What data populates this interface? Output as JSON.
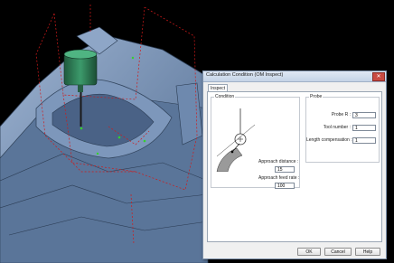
{
  "dialog": {
    "title": "Calculation Condition (OM Inspect)",
    "close_glyph": "✕",
    "tab_label": "Inspect",
    "condition": {
      "legend": "Condition",
      "approach_distance_label": "Approach distance :",
      "approach_distance_value": "15",
      "approach_feed_rate_label": "Approach feed rate :",
      "approach_feed_rate_value": "100"
    },
    "probe": {
      "legend": "Probe",
      "probe_r_label": "Probe R :",
      "probe_r_value": "3",
      "tool_number_label": "Tool number :",
      "tool_number_value": "1",
      "length_compensation_label": "Length compensation :",
      "length_compensation_value": "1"
    },
    "buttons": {
      "ok": "OK",
      "cancel": "Cancel",
      "help": "Help"
    }
  },
  "icons": [
    "close-icon",
    "probe-diagram-icon"
  ],
  "colors": {
    "part_blue": "#6a86aa",
    "tool_green": "#2f7a55",
    "path_red": "#d11a1a",
    "point_green": "#35d12e",
    "window_frame": "#c4d3e6"
  }
}
